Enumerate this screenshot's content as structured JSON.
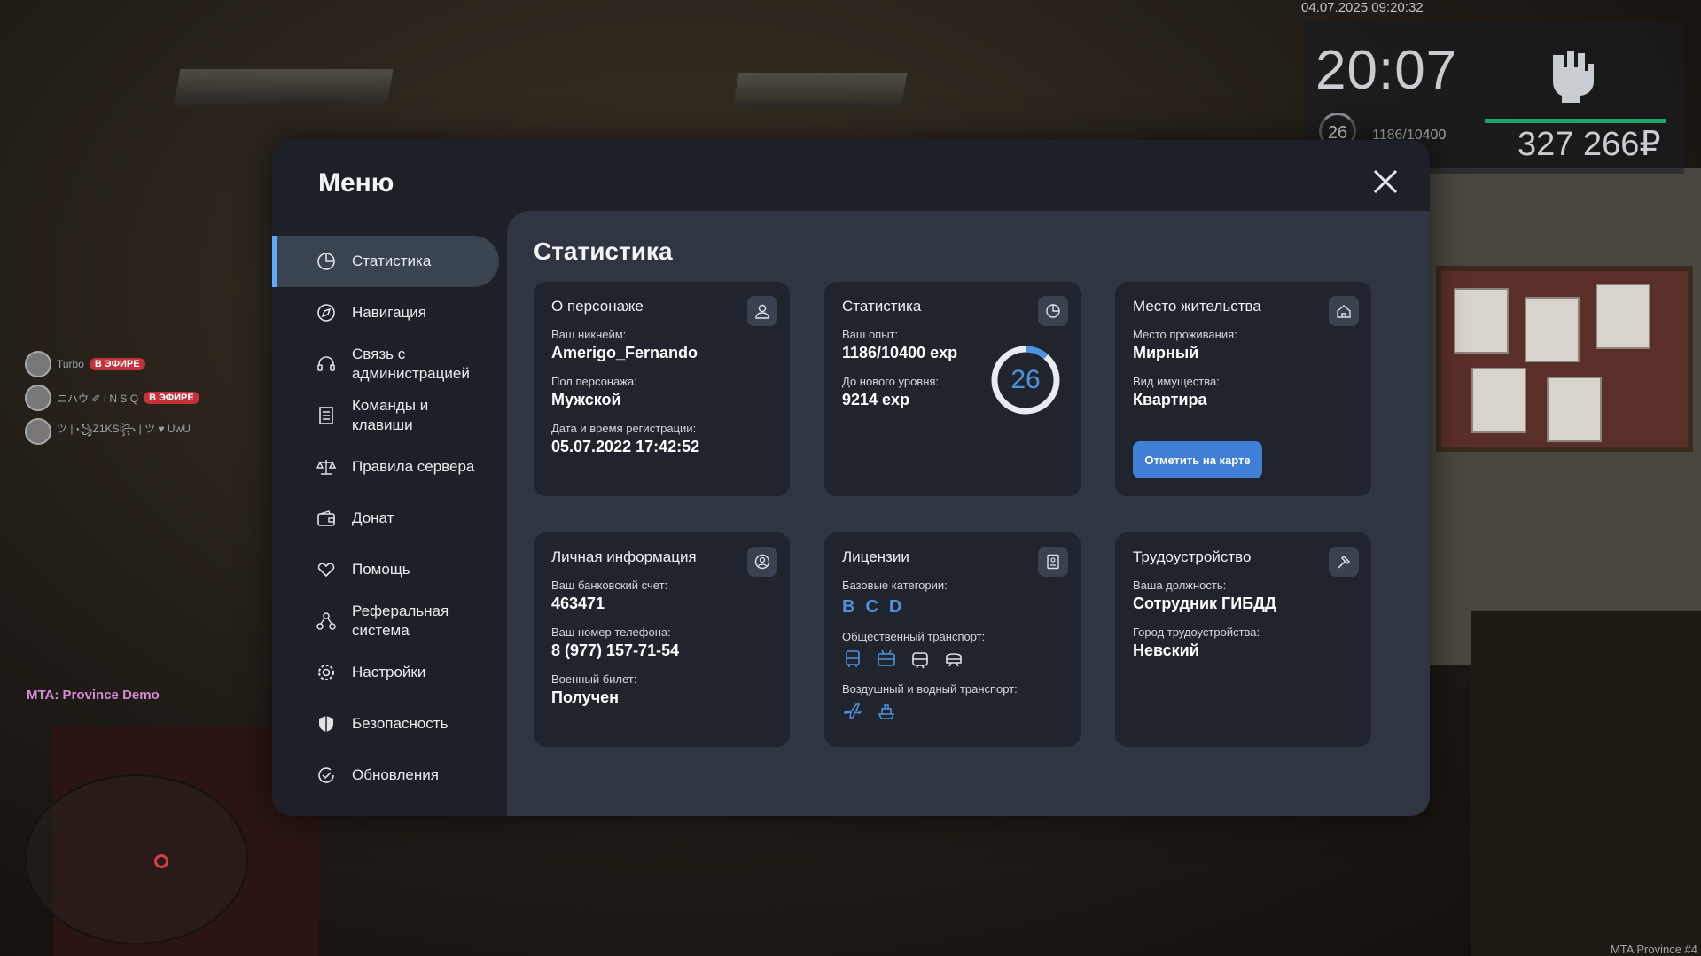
{
  "hud": {
    "datetime": "04.07.2025 09:20:32",
    "time": "20:07",
    "level": "26",
    "exp": "1186/10400",
    "exp_progress": 0.114,
    "money": "327 266₽"
  },
  "chat": [
    {
      "name": "Turbo",
      "badge": "В ЭФИРЕ"
    },
    {
      "name": "ニハウ ✐ I N S Q",
      "badge": "В ЭФИРЕ"
    },
    {
      "name": "ツ | ꧁Z1KS꧂ | ツ ♥ UwU",
      "badge": ""
    }
  ],
  "server_tag": "MTA: Province Demo",
  "watermark": "MTA Province #4",
  "menu": {
    "title": "Меню",
    "nav": [
      {
        "label": "Статистика",
        "icon": "pie-chart-icon",
        "active": true
      },
      {
        "label": "Навигация",
        "icon": "compass-icon",
        "active": false
      },
      {
        "label": "Связь с администрацией",
        "icon": "headset-icon",
        "active": false
      },
      {
        "label": "Команды и клавиши",
        "icon": "document-list-icon",
        "active": false
      },
      {
        "label": "Правила сервера",
        "icon": "scales-icon",
        "active": false
      },
      {
        "label": "Донат",
        "icon": "wallet-icon",
        "active": false
      },
      {
        "label": "Помощь",
        "icon": "heart-hand-icon",
        "active": false
      },
      {
        "label": "Реферальная система",
        "icon": "referral-icon",
        "active": false
      },
      {
        "label": "Настройки",
        "icon": "gear-icon",
        "active": false
      },
      {
        "label": "Безопасность",
        "icon": "shield-icon",
        "active": false
      },
      {
        "label": "Обновления",
        "icon": "refresh-check-icon",
        "active": false
      }
    ]
  },
  "stats": {
    "title": "Статистика",
    "character": {
      "title": "О персонаже",
      "nickname_label": "Ваш никнейм:",
      "nickname": "Amerigo_Fernando",
      "gender_label": "Пол персонажа:",
      "gender": "Мужской",
      "reg_label": "Дата и время регистрации:",
      "reg": "05.07.2022 17:42:52"
    },
    "statistics": {
      "title": "Статистика",
      "exp_label": "Ваш опыт:",
      "exp": "1186/10400 exp",
      "next_label": "До нового уровня:",
      "next": "9214 exp",
      "level": "26",
      "progress": 0.114
    },
    "residence": {
      "title": "Место жительства",
      "place_label": "Место проживания:",
      "place": "Мирный",
      "property_label": "Вид имущества:",
      "property": "Квартира",
      "map_button": "Отметить на карте"
    },
    "personal": {
      "title": "Личная информация",
      "bank_label": "Ваш банковский счет:",
      "bank": "463471",
      "phone_label": "Ваш номер телефона:",
      "phone": "8 (977) 157-71-54",
      "military_label": "Военный билет:",
      "military": "Получен"
    },
    "licenses": {
      "title": "Лицензии",
      "base_label": "Базовые категории:",
      "categories": [
        "B",
        "C",
        "D"
      ],
      "public_label": "Общественный транспорт:",
      "public_icons": [
        "bus-icon",
        "trolleybus-icon",
        "tram-icon",
        "metro-icon"
      ],
      "air_label": "Воздушный и водный транспорт:",
      "air_icons": [
        "plane-icon",
        "ship-icon"
      ]
    },
    "employment": {
      "title": "Трудоустройство",
      "position_label": "Ваша должность:",
      "position": "Сотрудник ГИБДД",
      "city_label": "Город трудоустройства:",
      "city": "Невский"
    }
  },
  "colors": {
    "accent": "#4f93e0",
    "active_bar": "#5aa9ff",
    "live_badge": "#c5313a",
    "hud_bar": "#1ea36a"
  }
}
